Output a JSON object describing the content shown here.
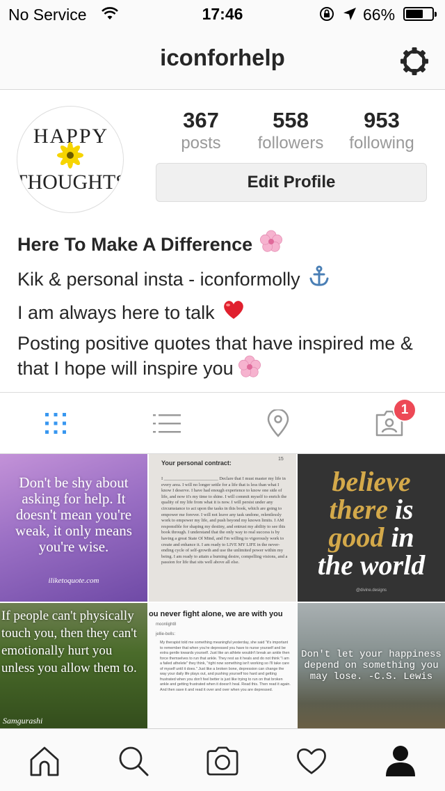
{
  "status_bar": {
    "carrier": "No Service",
    "time": "17:46",
    "battery_percent": "66%",
    "battery_level": 0.66
  },
  "nav": {
    "username": "iconforhelp"
  },
  "profile": {
    "avatar_text_top": "HAPPY",
    "avatar_text_bottom": "THOUGHTS",
    "stats": {
      "posts_count": "367",
      "posts_label": "posts",
      "followers_count": "558",
      "followers_label": "followers",
      "following_count": "953",
      "following_label": "following"
    },
    "edit_button": "Edit Profile"
  },
  "bio": {
    "name": "Here To Make A Difference",
    "line1": "Kik & personal insta - iconformolly",
    "line2": "I am always here to talk",
    "line3": "Posting positive quotes that have inspired me & that I hope will inspire you",
    "emoji_flower": "cherry-blossom",
    "emoji_anchor": "anchor",
    "emoji_heart": "red-heart"
  },
  "tabs": {
    "icons": [
      "grid-icon",
      "list-icon",
      "location-icon",
      "tagged-icon"
    ],
    "tagged_badge": "1"
  },
  "posts": [
    {
      "text": "Don't be shy about asking for help. It doesn't mean you're weak, it only means you're wise.",
      "source": "iliketoquote.com"
    },
    {
      "title": "Your personal contract:",
      "page": "15",
      "body": "I ________________________ Declare that I must master my life in every area. I will no longer settle for a life that is less than what I know I deserve. I have had enough experience to know one side of life, and now it's my time to shine. I will commit myself to enrich the quality of my life from what it is now. I will persist under any circumstance to act upon the tasks in this book, which are going to empower me forever. I will not leave any task undone, relentlessly work to empower my life, and push beyond my known limits. I AM responsible for shaping my destiny, and entrust my ability to see this book through. I understand that the only way to real success is by having a great State Of Mind, and I'm willing to vigorously work to create and enhance it. I am ready to LIVE MY LIFE in the never-ending cycle of self-growth and use the unlimited power within my being. I am ready to attain a burning desire, compelling visions, and a passion for life that sits well above all else."
    },
    {
      "line1a": "believe",
      "line2a": "there",
      "line2b": "is",
      "line3a": "good",
      "line3b": "in",
      "line4a": "the",
      "line4b": "world",
      "credit": "@divine.designs"
    },
    {
      "text": "If people can't physically touch you, then they can't emotionally hurt you unless you allow them to.",
      "signature": "Samgurashi"
    },
    {
      "headline": "ou never fight alone, we are with you",
      "user1": "moonlight8",
      "user2": "jellie-bells:",
      "body": "My therapist told me something meaningful yesterday, she said \"it's important to remember that when you're depressed you have to nurse yourself and be extra gentle towards yourself. Just like an athlete wouldn't break an ankle then force themselves to run that ankle. They rest as it heals and do not think \"I am a failed athelete\" they think, \"right now something isn't working so I'll take care of myself until it does.\" Just like a broken bone, depression can change the way your daily life plays out, and pushing yourself too hard and getting frustrated when you don't feel better is just like trying to run on that broken ankle and getting frustrated when it doesn't heal. Read this. Then read it again. And then save it and read it over and over when you are depressed."
    },
    {
      "text": "Don't let your happiness depend on something you may lose. -C.S. Lewis"
    }
  ],
  "tabbar": {
    "icons": [
      "home-icon",
      "search-icon",
      "camera-icon",
      "heart-icon",
      "profile-icon"
    ]
  }
}
